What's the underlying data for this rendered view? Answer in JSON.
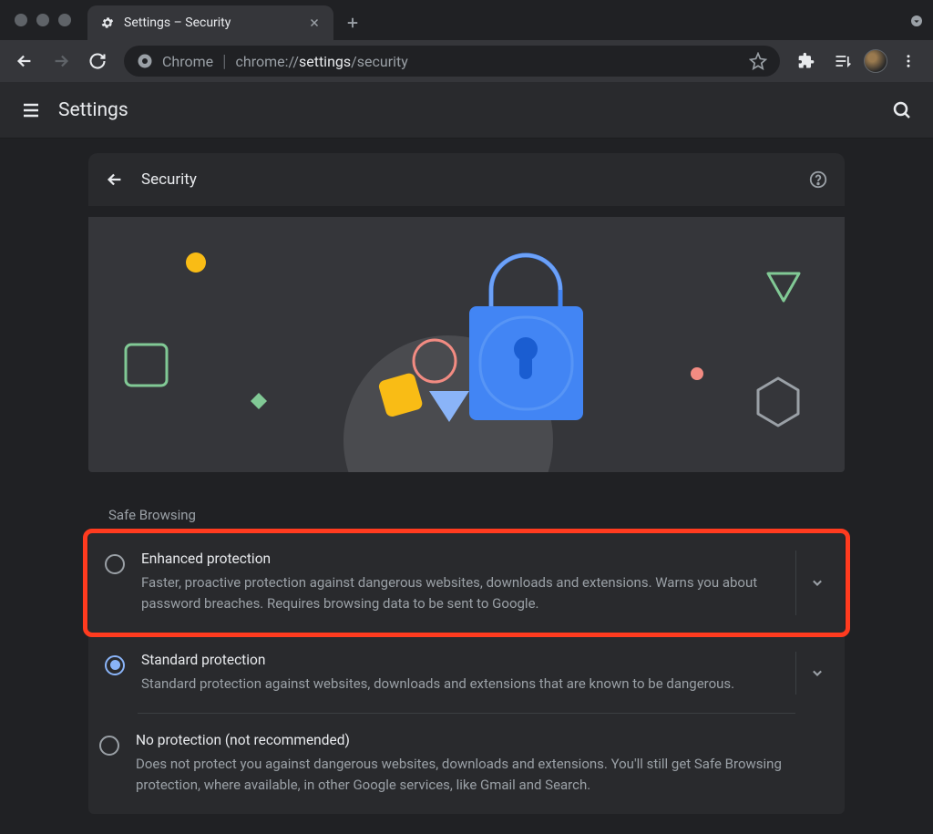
{
  "window": {
    "tab_title": "Settings – Security"
  },
  "toolbar": {
    "browser_label": "Chrome",
    "url_prefix": "chrome://",
    "url_bold": "settings",
    "url_suffix": "/security"
  },
  "app": {
    "title": "Settings"
  },
  "section": {
    "title": "Security"
  },
  "subtitle": "Safe Browsing",
  "options": [
    {
      "title": "Enhanced protection",
      "desc": "Faster, proactive protection against dangerous websites, downloads and extensions. Warns you about password breaches. Requires browsing data to be sent to Google.",
      "selected": false,
      "expandable": true,
      "highlighted": true
    },
    {
      "title": "Standard protection",
      "desc": "Standard protection against websites, downloads and extensions that are known to be dangerous.",
      "selected": true,
      "expandable": true,
      "highlighted": false
    },
    {
      "title": "No protection (not recommended)",
      "desc": "Does not protect you against dangerous websites, downloads and extensions. You'll still get Safe Browsing protection, where available, in other Google services, like Gmail and Search.",
      "selected": false,
      "expandable": false,
      "highlighted": false
    }
  ]
}
